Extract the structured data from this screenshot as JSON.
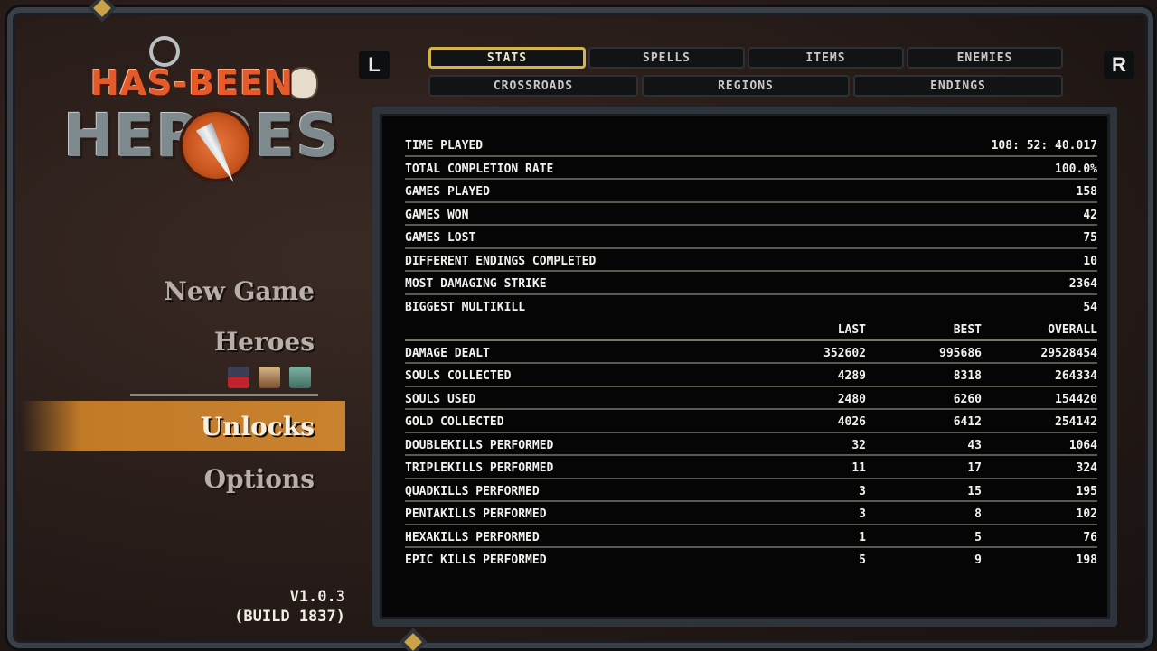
{
  "logo": {
    "line1": "HAS-BEEN",
    "line2": "HEROES"
  },
  "shoulders": {
    "left": "L",
    "right": "R"
  },
  "menu": {
    "items": [
      {
        "label": "New Game"
      },
      {
        "label": "Heroes"
      },
      {
        "label": "Unlocks"
      },
      {
        "label": "Options"
      }
    ],
    "selected": "Unlocks"
  },
  "version": {
    "line1": "V1.0.3",
    "line2": "(BUILD 1837)"
  },
  "tabs": {
    "row1": [
      "STATS",
      "SPELLS",
      "ITEMS",
      "ENEMIES"
    ],
    "row2": [
      "CROSSROADS",
      "REGIONS",
      "ENDINGS"
    ],
    "active": "STATS"
  },
  "stats": {
    "general": [
      {
        "label": "TIME PLAYED",
        "value": "108: 52: 40.017"
      },
      {
        "label": "TOTAL COMPLETION RATE",
        "value": "100.0%"
      },
      {
        "label": "GAMES PLAYED",
        "value": "158"
      },
      {
        "label": "GAMES WON",
        "value": "42"
      },
      {
        "label": "GAMES LOST",
        "value": "75"
      },
      {
        "label": "DIFFERENT ENDINGS COMPLETED",
        "value": "10"
      },
      {
        "label": "MOST DAMAGING STRIKE",
        "value": "2364"
      },
      {
        "label": "BIGGEST MULTIKILL",
        "value": "54"
      }
    ],
    "columns": [
      "LAST",
      "BEST",
      "OVERALL"
    ],
    "detailed": [
      {
        "label": "DAMAGE DEALT",
        "last": "352602",
        "best": "995686",
        "overall": "29528454"
      },
      {
        "label": "SOULS COLLECTED",
        "last": "4289",
        "best": "8318",
        "overall": "264334"
      },
      {
        "label": "SOULS USED",
        "last": "2480",
        "best": "6260",
        "overall": "154420"
      },
      {
        "label": "GOLD COLLECTED",
        "last": "4026",
        "best": "6412",
        "overall": "254142"
      },
      {
        "label": "DOUBLEKILLS PERFORMED",
        "last": "32",
        "best": "43",
        "overall": "1064"
      },
      {
        "label": "TRIPLEKILLS PERFORMED",
        "last": "11",
        "best": "17",
        "overall": "324"
      },
      {
        "label": "QUADKILLS PERFORMED",
        "last": "3",
        "best": "15",
        "overall": "195"
      },
      {
        "label": "PENTAKILLS PERFORMED",
        "last": "3",
        "best": "8",
        "overall": "102"
      },
      {
        "label": "HEXAKILLS PERFORMED",
        "last": "1",
        "best": "5",
        "overall": "76"
      },
      {
        "label": "EPIC KILLS PERFORMED",
        "last": "5",
        "best": "9",
        "overall": "198"
      }
    ]
  },
  "colors": {
    "accent": "#d6b24a",
    "selection": "#c98330",
    "text": "#f2f2ee"
  }
}
